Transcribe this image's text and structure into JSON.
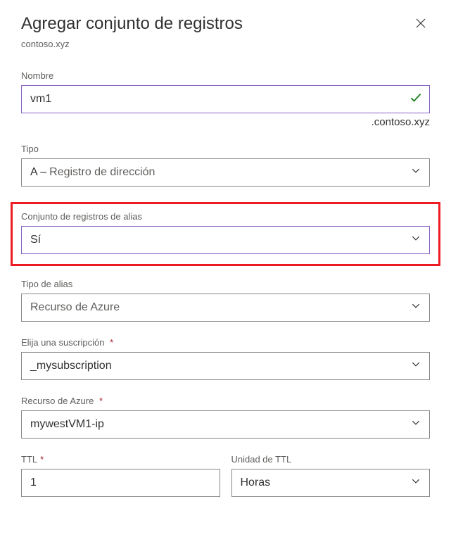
{
  "header": {
    "title": "Agregar conjunto de registros",
    "subtitle": "contoso.xyz"
  },
  "fields": {
    "name": {
      "label": "Nombre",
      "value": "vm1",
      "suffix": ".contoso.xyz"
    },
    "type": {
      "label": "Tipo",
      "prefix": "A –",
      "value": "Registro de dirección"
    },
    "aliasSet": {
      "label": "Conjunto de registros de alias",
      "value": "Sí"
    },
    "aliasType": {
      "label": "Tipo de alias",
      "value": "Recurso de Azure"
    },
    "subscription": {
      "label": "Elija una suscripción",
      "value": "_mysubscription"
    },
    "azureResource": {
      "label": "Recurso de Azure",
      "value": "mywestVM1-ip"
    },
    "ttl": {
      "label": "TTL",
      "value": "1"
    },
    "ttlUnit": {
      "label": "Unidad de TTL",
      "value": "Horas"
    }
  },
  "marks": {
    "required": "*"
  }
}
